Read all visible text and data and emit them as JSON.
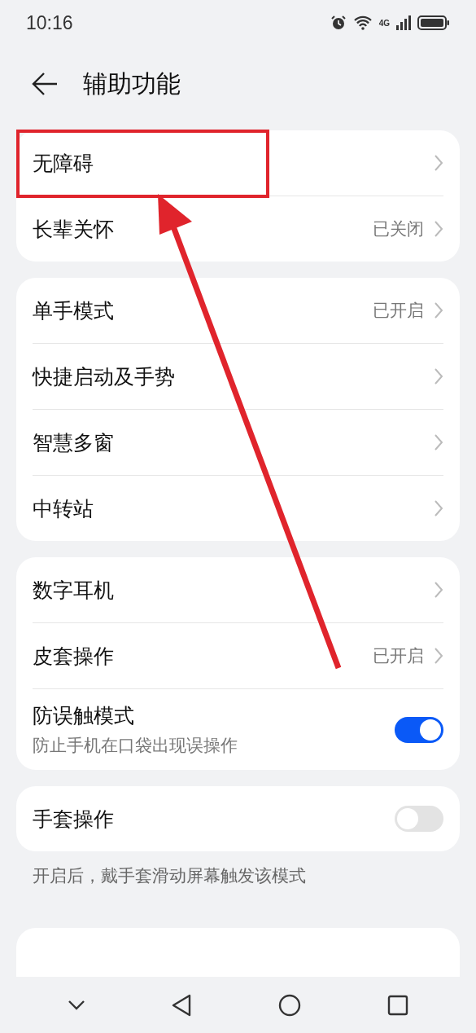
{
  "status_bar": {
    "time": "10:16",
    "network": "4G"
  },
  "header": {
    "title": "辅助功能"
  },
  "groups": [
    {
      "items": [
        {
          "kind": "link",
          "label": "无障碍"
        },
        {
          "kind": "link",
          "label": "长辈关怀",
          "value": "已关闭"
        }
      ]
    },
    {
      "items": [
        {
          "kind": "link",
          "label": "单手模式",
          "value": "已开启"
        },
        {
          "kind": "link",
          "label": "快捷启动及手势"
        },
        {
          "kind": "link",
          "label": "智慧多窗"
        },
        {
          "kind": "link",
          "label": "中转站"
        }
      ]
    },
    {
      "items": [
        {
          "kind": "link",
          "label": "数字耳机"
        },
        {
          "kind": "link",
          "label": "皮套操作",
          "value": "已开启"
        },
        {
          "kind": "switch",
          "label": "防误触模式",
          "subtitle": "防止手机在口袋出现误操作",
          "on": true
        }
      ]
    },
    {
      "items": [
        {
          "kind": "switch",
          "label": "手套操作",
          "on": false
        }
      ],
      "note": "开启后，戴手套滑动屏幕触发该模式"
    }
  ]
}
